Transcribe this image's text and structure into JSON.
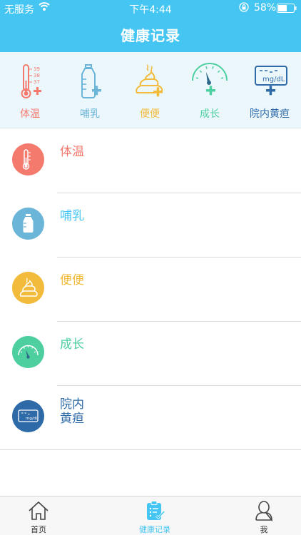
{
  "status_bar": {
    "carrier": "无服务",
    "time": "下午4:44",
    "battery": "58%"
  },
  "header": {
    "title": "健康记录"
  },
  "quick_actions": [
    {
      "label": "体温",
      "color": "#f47a6e",
      "icon": "thermometer-plus-icon",
      "marks": [
        "39",
        "38",
        "37"
      ]
    },
    {
      "label": "哺乳",
      "color": "#6ab5d8",
      "icon": "bottle-plus-icon"
    },
    {
      "label": "便便",
      "color": "#f3bb3c",
      "icon": "poop-plus-icon"
    },
    {
      "label": "成长",
      "color": "#4dcfa0",
      "icon": "gauge-plus-icon"
    },
    {
      "label": "院内黄疸",
      "color": "#2e6aa8",
      "icon": "bilirubin-meter-plus-icon",
      "unit": "mg/dL"
    }
  ],
  "records": [
    {
      "label": "体温",
      "color": "#f47a6e",
      "icon": "thermometer-icon"
    },
    {
      "label": "哺乳",
      "color": "#6ab5d8",
      "icon": "bottle-icon"
    },
    {
      "label": "便便",
      "color": "#f3bb3c",
      "icon": "poop-icon"
    },
    {
      "label": "成长",
      "color": "#4dcfa0",
      "icon": "gauge-icon"
    },
    {
      "label": "院内",
      "label2": "黄疸",
      "color": "#2e6aa8",
      "icon": "bilirubin-meter-icon",
      "unit": "mg/dL"
    }
  ],
  "tabs": [
    {
      "label": "首页",
      "icon": "home-icon"
    },
    {
      "label": "健康记录",
      "icon": "clipboard-check-icon"
    },
    {
      "label": "我",
      "icon": "person-icon"
    }
  ],
  "colors": {
    "header_bg": "#45c5f2",
    "quickbar_bg": "#ecf7fc",
    "active_tab": "#45c5f2"
  }
}
